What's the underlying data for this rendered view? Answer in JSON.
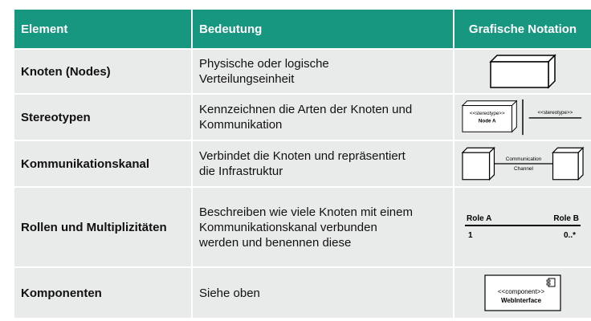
{
  "header": {
    "col1": "Element",
    "col2": "Bedeutung",
    "col3": "Grafische Notation"
  },
  "rows": [
    {
      "element": "Knoten (Nodes)",
      "meaning_lines": [
        "Physische oder logische",
        "Verteilungseinheit"
      ]
    },
    {
      "element": "Stereotypen",
      "meaning_lines": [
        "Kennzeichnen die Arten der Knoten und",
        "Kommunikation"
      ],
      "notation": {
        "node_stereotype": "<<stereotype>>",
        "node_name": "Node A",
        "line_stereotype": "<<stereotype>>"
      }
    },
    {
      "element": "Kommunikationskanal",
      "meaning_lines": [
        "Verbindet die Knoten und repräsentiert",
        "die Infrastruktur"
      ],
      "notation": {
        "channel_line1": "Communication",
        "channel_line2": "Channel"
      }
    },
    {
      "element": "Rollen und Multiplizitäten",
      "meaning_lines": [
        "Beschreiben wie viele Knoten mit einem",
        "Kommunikationskanal verbunden",
        "werden und benennen diese"
      ],
      "notation": {
        "role_a": "Role A",
        "role_b": "Role B",
        "mult_a": "1",
        "mult_b": "0..*"
      }
    },
    {
      "element": "Komponenten",
      "meaning_lines": [
        "Siehe oben"
      ],
      "notation": {
        "stereotype": "<<component>>",
        "name": "WebInterface"
      }
    }
  ],
  "colors": {
    "header_bg": "#17977f",
    "row_bg": "#e9eaea"
  }
}
